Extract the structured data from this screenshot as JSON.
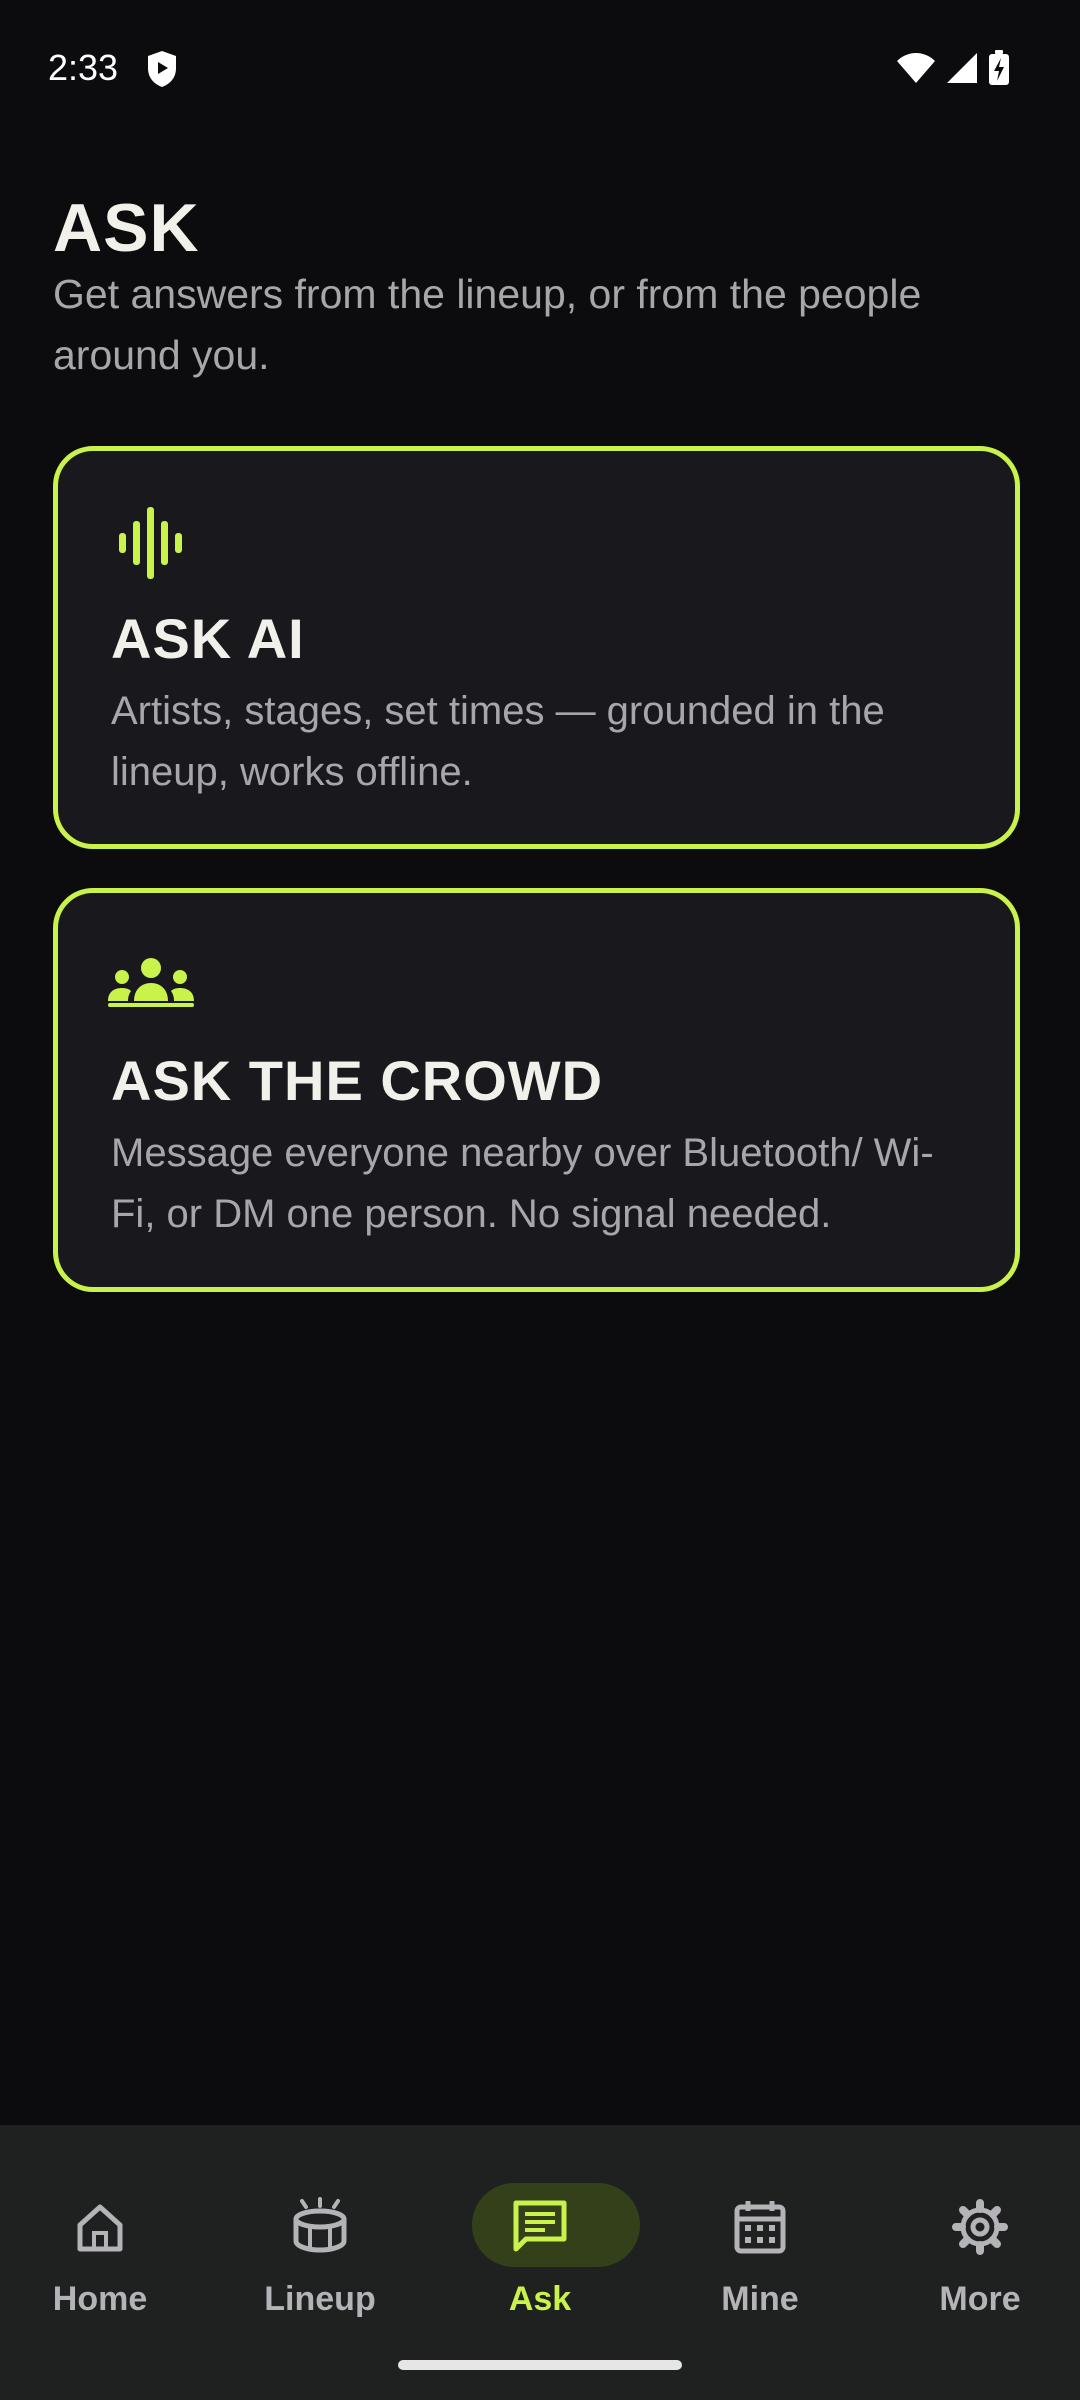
{
  "status_bar": {
    "time": "2:33",
    "icons": [
      "shield-icon",
      "wifi-icon",
      "signal-icon",
      "battery-charging-icon"
    ]
  },
  "header": {
    "title": "ASK",
    "subtitle": "Get answers from the lineup, or from the people around you."
  },
  "cards": [
    {
      "icon": "waveform-icon",
      "title": "ASK AI",
      "description": "Artists, stages, set times — grounded in the lineup, works offline."
    },
    {
      "icon": "group-icon",
      "title": "ASK THE CROWD",
      "description": "Message everyone nearby over Bluetooth/ Wi-Fi, or DM one person. No signal needed."
    }
  ],
  "nav": {
    "items": [
      {
        "label": "Home",
        "icon": "home-icon",
        "active": false
      },
      {
        "label": "Lineup",
        "icon": "stage-icon",
        "active": false
      },
      {
        "label": "Ask",
        "icon": "chat-icon",
        "active": true
      },
      {
        "label": "Mine",
        "icon": "calendar-icon",
        "active": false
      },
      {
        "label": "More",
        "icon": "gear-icon",
        "active": false
      }
    ]
  },
  "colors": {
    "background": "#0c0c0e",
    "card": "#19191d",
    "accent": "#c9f24a",
    "text_primary": "#f2f0ea",
    "text_secondary": "#a6a6ab",
    "nav_background": "#1f2020"
  }
}
